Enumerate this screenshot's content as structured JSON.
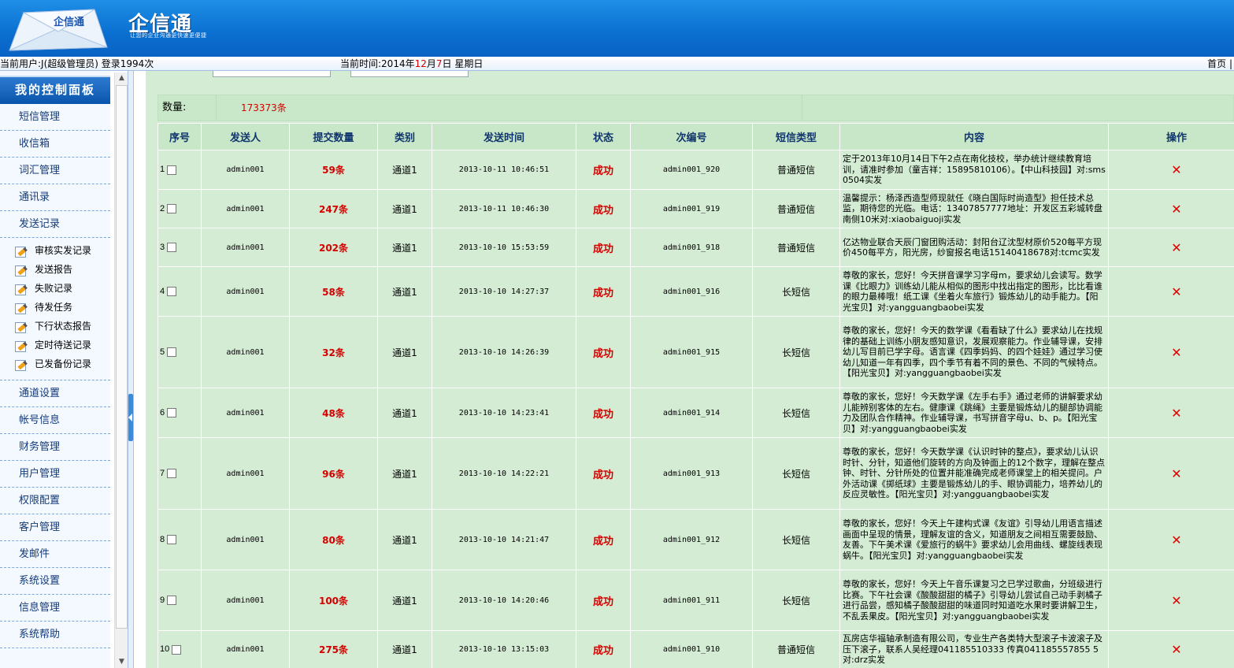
{
  "header": {
    "brand_title": "企信通",
    "brand_slogan": "让您的企业沟通更快速更便捷",
    "logo_text": "企信通"
  },
  "statusbar": {
    "user_prefix": "当前用户:",
    "user_text": "J(超级管理员) 登录1994次",
    "time_prefix": "当前时间:",
    "time_year": "2014年",
    "time_month": "12",
    "time_month_unit": "月",
    "time_day": "7",
    "time_day_unit": "日",
    "time_weekday": "星期日",
    "home_link": "首页 |"
  },
  "sidebar": {
    "panel_title": "我的控制面板",
    "top_items": [
      "短信管理",
      "收信箱",
      "词汇管理",
      "通讯录",
      "发送记录"
    ],
    "sub_items": [
      "审核实发记录",
      "发送报告",
      "失败记录",
      "待发任务",
      "下行状态报告",
      "定时待送记录",
      "已发备份记录"
    ],
    "bottom_items": [
      "通道设置",
      "帐号信息",
      "财务管理",
      "用户管理",
      "权限配置",
      "客户管理",
      "发邮件",
      "系统设置",
      "信息管理",
      "系统帮助"
    ]
  },
  "summary": {
    "count_label": "数量:",
    "count_value": "173373条"
  },
  "table": {
    "headers": [
      "序号",
      "发送人",
      "提交数量",
      "类别",
      "发送时间",
      "状态",
      "次编号",
      "短信类型",
      "内容",
      "操作"
    ],
    "rows": [
      {
        "seq": "1",
        "sender": "admin001",
        "count": "59条",
        "category": "通道1",
        "time": "2013-10-11 10:46:51",
        "status": "成功",
        "batch": "admin001_920",
        "type": "普通短信",
        "content": "定于2013年10月14日下午2点在南化技校，举办统计继续教育培训，请准时参加（童吉祥：15895810106）。【中山科技园】对:sms0504实发"
      },
      {
        "seq": "2",
        "sender": "admin001",
        "count": "247条",
        "category": "通道1",
        "time": "2013-10-11 10:46:30",
        "status": "成功",
        "batch": "admin001_919",
        "type": "普通短信",
        "content": "温馨提示：杨泽西造型师现就任《晓白国际时尚造型》担任技术总监，期待您的光临。电话：13407857777地址：开发区五彩城转盘南侧10米对:xiaobaiguoji实发"
      },
      {
        "seq": "3",
        "sender": "admin001",
        "count": "202条",
        "category": "通道1",
        "time": "2013-10-10 15:53:59",
        "status": "成功",
        "batch": "admin001_918",
        "type": "普通短信",
        "content": "亿达物业联合天辰门窗团购活动：封阳台辽沈型材原价520每平方现价450每平方，阳光房，纱窗报名电话15140418678对:tcmc实发"
      },
      {
        "seq": "4",
        "sender": "admin001",
        "count": "58条",
        "category": "通道1",
        "time": "2013-10-10 14:27:37",
        "status": "成功",
        "batch": "admin001_916",
        "type": "长短信",
        "content": "尊敬的家长，您好！今天拼音课学习字母m，要求幼儿会读写。数学课《比眼力》训练幼儿能从相似的图形中找出指定的图形，比比看谁的眼力最棒哦！纸工课《坐着火车旅行》锻炼幼儿的动手能力。【阳光宝贝】对:yangguangbaobei实发"
      },
      {
        "seq": "5",
        "sender": "admin001",
        "count": "32条",
        "category": "通道1",
        "time": "2013-10-10 14:26:39",
        "status": "成功",
        "batch": "admin001_915",
        "type": "长短信",
        "content": "尊敬的家长，您好！今天的数学课《看看缺了什么》要求幼儿在找规律的基础上训练小朋友感知意识，发展观察能力。作业辅导课，安排幼儿写目前已学字母。语言课《四季妈妈、的四个娃娃》通过学习使幼儿知道一年有四季，四个季节有着不同的景色、不同的气候特点。【阳光宝贝】对:yangguangbaobei实发"
      },
      {
        "seq": "6",
        "sender": "admin001",
        "count": "48条",
        "category": "通道1",
        "time": "2013-10-10 14:23:41",
        "status": "成功",
        "batch": "admin001_914",
        "type": "长短信",
        "content": "尊敬的家长，您好！今天数学课《左手右手》通过老师的讲解要求幼儿能辨别客体的左右。健康课《跳绳》主要是锻炼幼儿的腿部协调能力及团队合作精神。作业辅导课，书写拼音字母u、b、p。【阳光宝贝】对:yangguangbaobei实发"
      },
      {
        "seq": "7",
        "sender": "admin001",
        "count": "96条",
        "category": "通道1",
        "time": "2013-10-10 14:22:21",
        "status": "成功",
        "batch": "admin001_913",
        "type": "长短信",
        "content": "尊敬的家长，您好！今天数学课《认识时钟的整点》，要求幼儿认识时针、分针，知道他们旋转的方向及钟面上的12个数字，理解在整点钟、时针、分针所处的位置并能准确完成老师课堂上的相关提问。户外活动课《掷纸球》主要是锻炼幼儿的手、眼协调能力，培养幼儿的反应灵敏性。【阳光宝贝】对:yangguangbaobei实发"
      },
      {
        "seq": "8",
        "sender": "admin001",
        "count": "80条",
        "category": "通道1",
        "time": "2013-10-10 14:21:47",
        "status": "成功",
        "batch": "admin001_912",
        "type": "长短信",
        "content": "尊敬的家长，您好！今天上午建构式课《友谊》引导幼儿用语言描述画面中呈现的情景，理解友谊的含义，知道朋友之间相互需要鼓励、友善。下午美术课《爱旅行的蜗牛》要求幼儿会用曲线、螺旋线表现蜗牛。【阳光宝贝】对:yangguangbaobei实发"
      },
      {
        "seq": "9",
        "sender": "admin001",
        "count": "100条",
        "category": "通道1",
        "time": "2013-10-10 14:20:46",
        "status": "成功",
        "batch": "admin001_911",
        "type": "长短信",
        "content": "尊敬的家长，您好！今天上午音乐课复习之已学过歌曲，分班级进行比赛。下午社会课《酸酸甜甜的橘子》引导幼儿尝试自己动手剥橘子进行品尝，感知橘子酸酸甜甜的味道同时知道吃水果时要讲解卫生，不乱丢果皮。【阳光宝贝】对:yangguangbaobei实发"
      },
      {
        "seq": "10",
        "sender": "admin001",
        "count": "275条",
        "category": "通道1",
        "time": "2013-10-10 13:15:03",
        "status": "成功",
        "batch": "admin001_910",
        "type": "普通短信",
        "content": "瓦房店华福轴承制造有限公司，专业生产各类特大型滚子卡波滚子及压下滚子，联系人吴经理041185510333 传真041185557855 5对:drz实发"
      }
    ]
  },
  "colors": {
    "header_blue": "#0a6fd0",
    "main_green": "#d3ecd3",
    "accent_red": "#d40000"
  },
  "icons": {
    "submenu_icon": "pencil-note-icon",
    "delete_icon": "delete-x-icon"
  }
}
